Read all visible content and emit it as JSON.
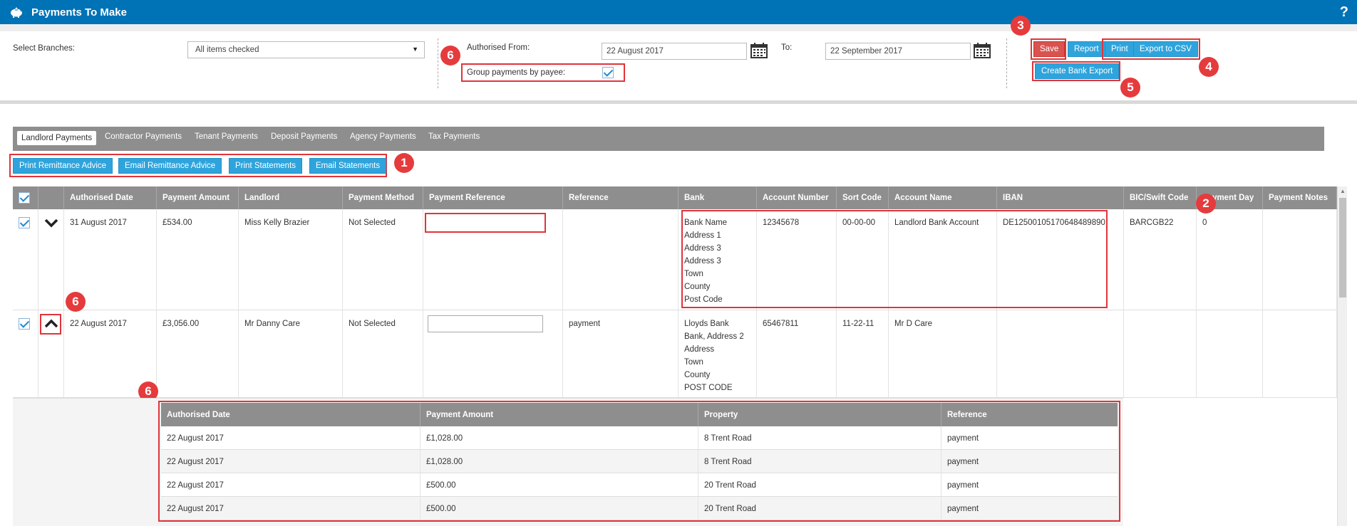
{
  "window": {
    "title": "Payments To Make",
    "help": "?",
    "app_icon": "piggy-bank-icon",
    "help_icon": "question-icon"
  },
  "filters": {
    "branches_label": "Select Branches:",
    "branches_value": "All items checked",
    "authorised_from_label": "Authorised From:",
    "authorised_from_value": "22 August 2017",
    "to_label": "To:",
    "to_value": "22 September 2017",
    "group_by_payee_label": "Group payments by payee:",
    "group_by_payee_checked": true
  },
  "actions": {
    "save": "Save",
    "report": "Report",
    "print": "Print",
    "export_csv": "Export to CSV",
    "bank_export": "Create Bank Export"
  },
  "tabs": [
    "Landlord Payments",
    "Contractor Payments",
    "Tenant Payments",
    "Deposit Payments",
    "Agency Payments",
    "Tax Payments"
  ],
  "bulk_actions": [
    "Print Remittance Advice",
    "Email Remittance Advice",
    "Print Statements",
    "Email Statements"
  ],
  "annotations": [
    "1",
    "2",
    "3",
    "4",
    "5",
    "6",
    "6",
    "6"
  ],
  "grid": {
    "columns": [
      "Authorised Date",
      "Payment Amount",
      "Landlord",
      "Payment Method",
      "Payment Reference",
      "Reference",
      "Bank",
      "Account Number",
      "Sort Code",
      "Account Name",
      "IBAN",
      "BIC/Swift Code",
      "Payment Day",
      "Payment Notes"
    ],
    "rows": [
      {
        "checked": true,
        "expanded": false,
        "authorised_date": "31 August 2017",
        "amount": "£534.00",
        "landlord": "Miss Kelly Brazier",
        "method": "Not Selected",
        "reference": "",
        "bank": [
          "Bank Name",
          "Address 1",
          "Address 3",
          "Address 3",
          "Town",
          "County",
          "Post Code"
        ],
        "account_number": "12345678",
        "sort_code": "00-00-00",
        "account_name": "Landlord Bank Account",
        "iban": "DE12500105170648489890",
        "bic": "BARCGB22",
        "payment_day": "0",
        "notes": ""
      },
      {
        "checked": true,
        "expanded": true,
        "authorised_date": "22 August 2017",
        "amount": "£3,056.00",
        "landlord": "Mr Danny Care",
        "method": "Not Selected",
        "reference": "payment",
        "bank": [
          "Lloyds Bank",
          "Bank, Address 2",
          "Address",
          "Town",
          "County",
          "POST CODE"
        ],
        "account_number": "65467811",
        "sort_code": "11-22-11",
        "account_name": "Mr D Care",
        "iban": "",
        "bic": "",
        "payment_day": "",
        "notes": ""
      }
    ]
  },
  "subgrid": {
    "columns": [
      "Authorised Date",
      "Payment Amount",
      "Property",
      "Reference"
    ],
    "rows": [
      [
        "22 August 2017",
        "£1,028.00",
        "8 Trent Road",
        "payment"
      ],
      [
        "22 August 2017",
        "£1,028.00",
        "8 Trent Road",
        "payment"
      ],
      [
        "22 August 2017",
        "£500.00",
        "20 Trent Road",
        "payment"
      ],
      [
        "22 August 2017",
        "£500.00",
        "20 Trent Road",
        "payment"
      ]
    ]
  },
  "colors": {
    "titlebar": "#0072b6",
    "button": "#2fa4dc",
    "save": "#d9534f",
    "highlight": "#e0343a",
    "header": "#8e8e8e"
  }
}
